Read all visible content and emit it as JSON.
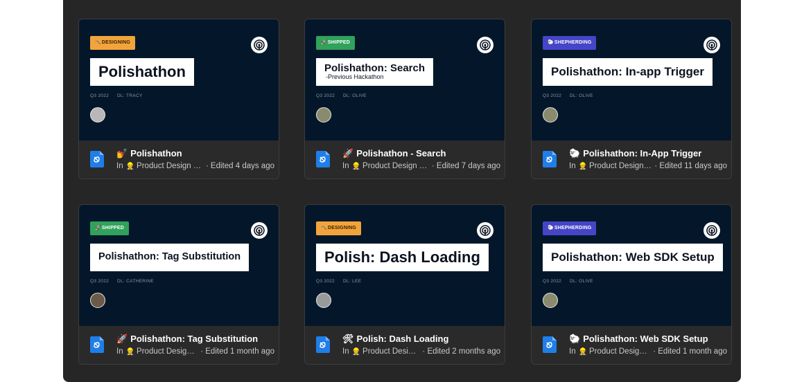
{
  "cards": [
    {
      "tag_type": "designing",
      "tag_glyph": "🔨",
      "tag_label": "DESIGNING",
      "cover_title": "Polishathon",
      "cover_subtitle": "",
      "quarter": "Q3 2022",
      "dl": "DL: TRACY",
      "avatar_color": "#b8b8b8",
      "title_emoji": "💅",
      "title": "Polishathon",
      "in_label": "In",
      "location_emoji": "👷",
      "location": "Product Design Team",
      "edited": "· Edited 4 days ago"
    },
    {
      "tag_type": "shipped",
      "tag_glyph": "🚀",
      "tag_label": "SHIPPED",
      "cover_title": "Polishathon: Search",
      "cover_subtitle": "-Previous Hackathon",
      "quarter": "Q3 2022",
      "dl": "DL: OLIVE",
      "avatar_color": "#8a8a6e",
      "title_emoji": "🚀",
      "title": "Polishathon - Search",
      "in_label": "In",
      "location_emoji": "👷",
      "location": "Product Design Team",
      "edited": "· Edited 7 days ago"
    },
    {
      "tag_type": "shepherding",
      "tag_glyph": "🐑",
      "tag_label": "SHEPHERDING",
      "cover_title": "Polishathon: In-app Trigger",
      "cover_subtitle": "",
      "quarter": "Q3 2022",
      "dl": "DL: OLIVE",
      "avatar_color": "#8a8a6e",
      "title_emoji": "🐑",
      "title": "Polishathon: In-App Trigger",
      "in_label": "In",
      "location_emoji": "👷",
      "location": "Product Design Team",
      "edited": "· Edited 11 days ago"
    },
    {
      "tag_type": "shipped",
      "tag_glyph": "🚀",
      "tag_label": "SHIPPED",
      "cover_title": "Polishathon: Tag Substitution",
      "cover_subtitle": "",
      "quarter": "Q3 2022",
      "dl": "DL: CATHERINE",
      "avatar_color": "#6b5a48",
      "title_emoji": "🚀",
      "title": "Polishathon: Tag Substitution",
      "in_label": "In",
      "location_emoji": "👷",
      "location": "Product Design Team",
      "edited": "· Edited 1 month ago"
    },
    {
      "tag_type": "designing",
      "tag_glyph": "🔨",
      "tag_label": "DESIGNING",
      "cover_title": "Polish: Dash Loading",
      "cover_subtitle": "",
      "quarter": "Q3 2022",
      "dl": "DL: LEE",
      "avatar_color": "#9a9a9a",
      "title_emoji": "🛠",
      "title": "Polish: Dash Loading",
      "in_label": "In",
      "location_emoji": "👷",
      "location": "Product Design Team",
      "edited": "· Edited 2 months ago"
    },
    {
      "tag_type": "shepherding",
      "tag_glyph": "🐑",
      "tag_label": "SHEPHERDING",
      "cover_title": "Polishathon: Web SDK Setup",
      "cover_subtitle": "",
      "quarter": "Q3 2022",
      "dl": "DL: OLIVE",
      "avatar_color": "#8a8a6e",
      "title_emoji": "🐑",
      "title": "Polishathon: Web SDK Setup",
      "in_label": "In",
      "location_emoji": "👷",
      "location": "Product Design Team",
      "edited": "· Edited 1 month ago"
    }
  ]
}
